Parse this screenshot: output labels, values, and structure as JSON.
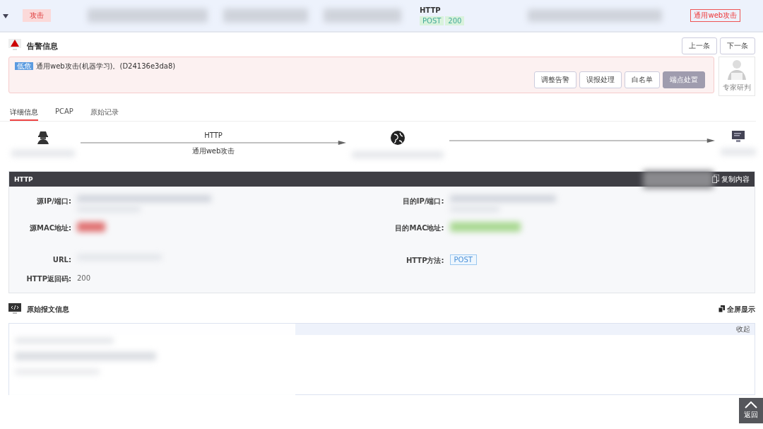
{
  "event_row": {
    "expanded": true,
    "tag": "攻击",
    "protocol": "HTTP",
    "method": "POST",
    "status_code": "200",
    "type_tag": "通用web攻击"
  },
  "alert": {
    "title": "告警信息",
    "nav_buttons": [
      "上一条",
      "下一条"
    ],
    "level": "低危",
    "message": "通用web攻击(机器学习)。(D24136e3da8)",
    "actions": [
      {
        "label": "调整告警",
        "disabled": false
      },
      {
        "label": "误报处理",
        "disabled": false
      },
      {
        "label": "白名单",
        "disabled": false
      },
      {
        "label": "端点处置",
        "disabled": true
      }
    ],
    "expert": "专家研判"
  },
  "tabs": [
    {
      "label": "详细信息",
      "selected": true
    },
    {
      "label": "PCAP",
      "selected": false
    },
    {
      "label": "原始记录",
      "selected": false
    }
  ],
  "flow": {
    "protocol": "HTTP",
    "attack": "通用web攻击"
  },
  "detail": {
    "title": "HTTP",
    "copy": "复制内容",
    "left": [
      {
        "label": "源IP/端口:"
      },
      {
        "label": "源MAC地址:"
      },
      {
        "label": "URL:"
      },
      {
        "label": "HTTP返回码:",
        "value": "200"
      }
    ],
    "right": [
      {
        "label": "目的IP/端口:",
        "kind": "plain"
      },
      {
        "label": "目的MAC地址:",
        "kind": "plain"
      },
      {
        "label": "HTTP方法:",
        "kind": "tag",
        "value": "POST"
      }
    ]
  },
  "raw": {
    "title": "原始报文信息",
    "fullscreen": "全屏显示",
    "collapse": "收起"
  },
  "back": "返回"
}
